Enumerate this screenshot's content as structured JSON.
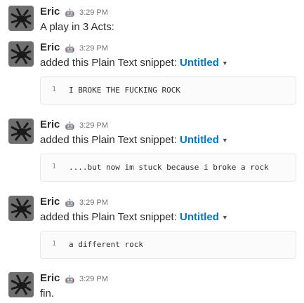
{
  "messages": [
    {
      "author": "Eric",
      "bot_icon": "robot-icon",
      "time": "3:29 PM",
      "text": "A play in 3 Acts:"
    },
    {
      "author": "Eric",
      "bot_icon": "robot-icon",
      "time": "3:29 PM",
      "prefix": "added this Plain Text snippet:",
      "snippet_title": "Untitled",
      "snippet": {
        "line_number": "1",
        "code": "I BROKE THE FUCKING ROCK"
      }
    },
    {
      "author": "Eric",
      "bot_icon": "robot-icon",
      "time": "3:29 PM",
      "prefix": "added this Plain Text snippet:",
      "snippet_title": "Untitled",
      "snippet": {
        "line_number": "1",
        "code": "....but now im stuck because i broke a rock"
      }
    },
    {
      "author": "Eric",
      "bot_icon": "robot-icon",
      "time": "3:29 PM",
      "prefix": "added this Plain Text snippet:",
      "snippet_title": "Untitled",
      "snippet": {
        "line_number": "1",
        "code": "a different rock"
      }
    },
    {
      "author": "Eric",
      "bot_icon": "robot-icon",
      "time": "3:29 PM",
      "text": "fin."
    }
  ],
  "colors": {
    "link": "#0576b9",
    "muted": "#717274",
    "text": "#2c2d30"
  }
}
